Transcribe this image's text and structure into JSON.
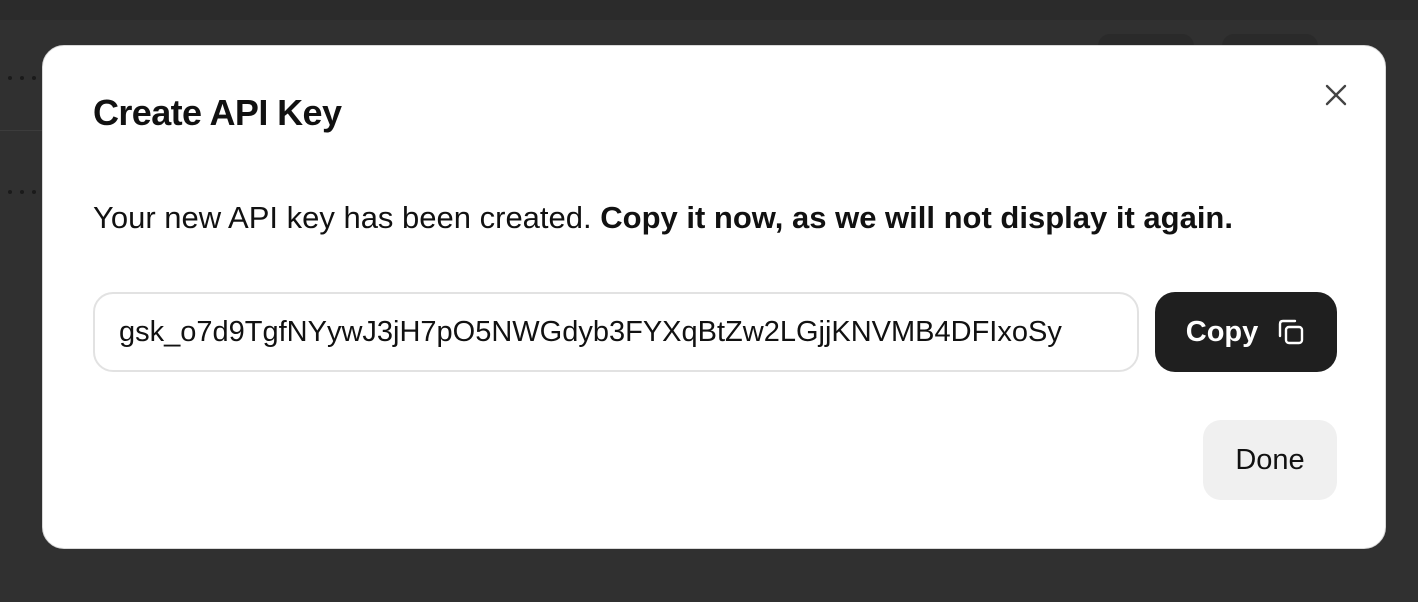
{
  "dialog": {
    "title": "Create API Key",
    "message_prefix": "Your new API key has been created.",
    "message_emphasis": "Copy it now, as we will not display it again.",
    "api_key_value": "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",
    "copy_label": "Copy",
    "done_label": "Done",
    "close_icon": "close-icon",
    "copy_icon": "copy-icon"
  },
  "colors": {
    "overlay": "#303030",
    "modal_background": "#ffffff",
    "primary_button": "#1f1f1f",
    "secondary_button": "#f0f0f0",
    "text": "#111111"
  }
}
